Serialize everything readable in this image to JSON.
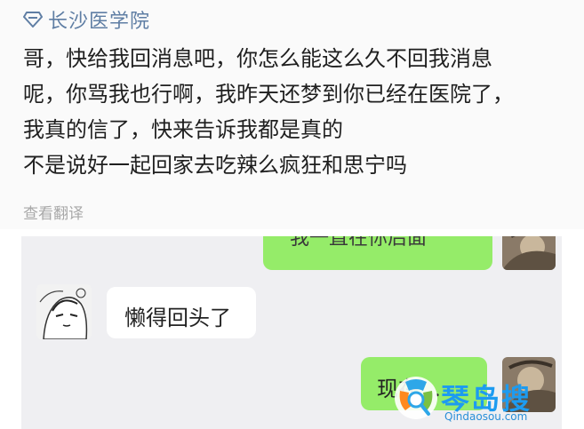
{
  "post": {
    "location_label": "长沙医学院",
    "lines": [
      "哥，快给我回消息吧，你怎么能这么久不回我消息",
      "呢，你骂我也行啊，我昨天还梦到你已经在医院了，",
      "我真的信了，快来告诉我都是真的",
      "不是说好一起回家去吃辣么疯狂和思宁吗"
    ],
    "translate_label": "查看翻译"
  },
  "chat": {
    "top_message_partial": "我一直在你后面",
    "incoming_message": "懒得回头了",
    "outgoing_message_partial": "现在…"
  },
  "watermark": {
    "name": "琴岛搜",
    "domain": "Qindaosou.com"
  },
  "colors": {
    "location_text": "#5f7ea4",
    "body_text": "#1f1f1f",
    "muted_text": "#a8a8a8",
    "chat_bg": "#efeff2",
    "bubble_out": "#95ec69",
    "bubble_in": "#ffffff"
  }
}
